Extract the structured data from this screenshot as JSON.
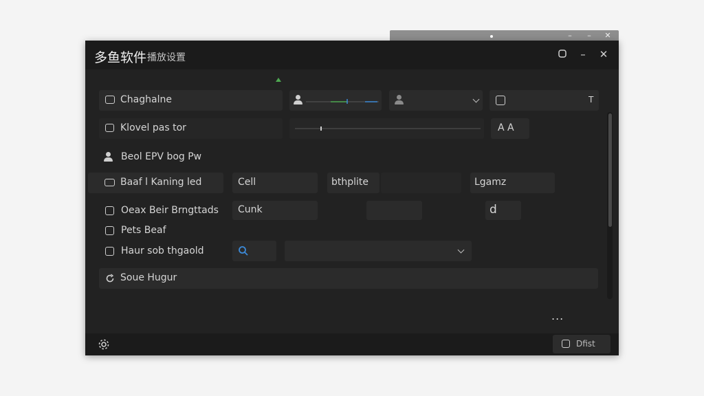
{
  "window": {
    "title": "多鱼软件",
    "subtitle": "播放设置"
  },
  "rows": {
    "r1_label": "Chaghalne",
    "r2_label": "Klovel pas tor",
    "r2_font_button": "A A",
    "r3_label": "Beol EPV bog Pw",
    "r4_label": "Baaf l Kaning led",
    "r4_field1": "Cell",
    "r4_field2": "bthplite",
    "r4_field3": "Lgamz",
    "r5_label": "Oeax Beir Brngttads",
    "r5_field1": "Cunk",
    "r5_field3": "d",
    "r6_label": "Pets Beaf",
    "r7_label": "Haur sob thgaold",
    "r8_label": "Soue Hugur"
  },
  "more_label": "...",
  "footer": {
    "button_label": "Dfist"
  },
  "colors": {
    "window_bg": "#222222",
    "titlebar_bg": "#1b1b1b",
    "field_bg": "#2b2b2b",
    "accent_green": "#4ea851",
    "search_blue": "#3c8ad8"
  }
}
